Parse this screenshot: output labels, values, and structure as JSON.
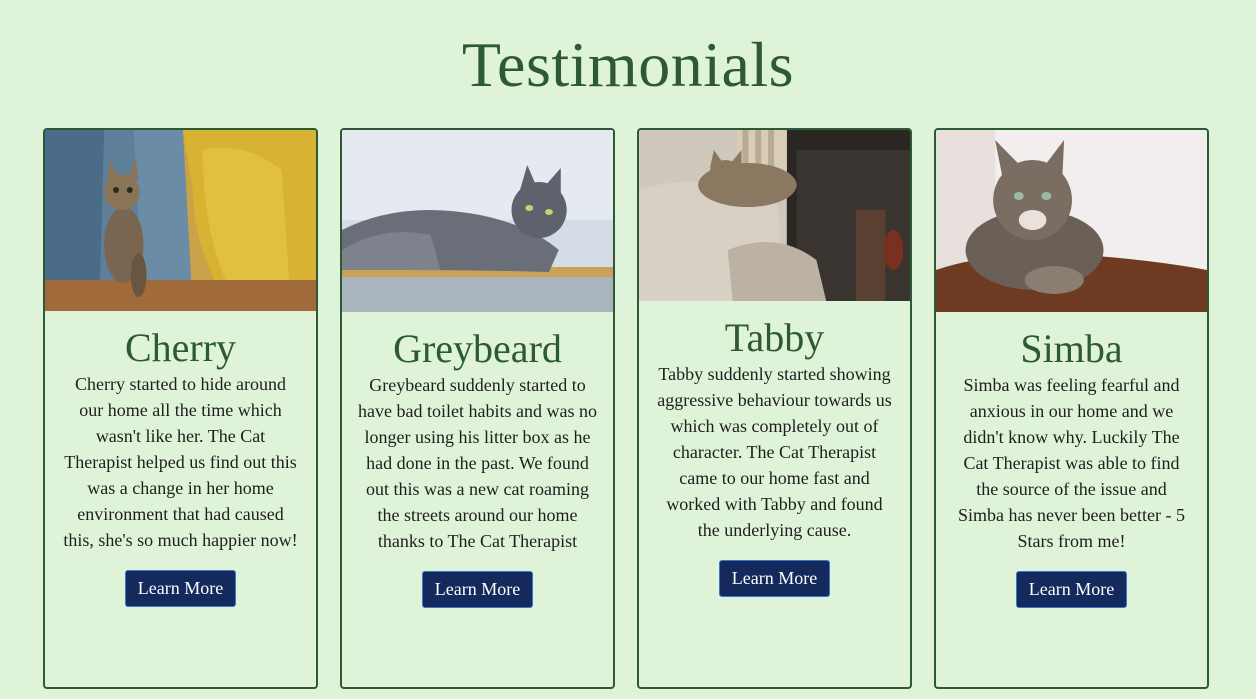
{
  "page": {
    "title": "Testimonials"
  },
  "colors": {
    "background": "#dff3d8",
    "heading": "#2d5a34",
    "border": "#2d5a34",
    "button": "#142a5c",
    "button_text": "#ffffff"
  },
  "cards": [
    {
      "name": "Cherry",
      "image": "cat-photo-cherry",
      "text": "Cherry started to hide around our home all the time which wasn't like her. The Cat Therapist helped us find out this was a change in her home environment that had caused this, she's so much happier now!",
      "button": "Learn More"
    },
    {
      "name": "Greybeard",
      "image": "cat-photo-greybeard",
      "text": "Greybeard suddenly started to have bad toilet habits and was no longer using his litter box as he had done in the past. We found out this was a new cat roaming the streets around our home thanks to The Cat Therapist",
      "button": "Learn More"
    },
    {
      "name": "Tabby",
      "image": "cat-photo-tabby",
      "text": "Tabby suddenly started showing aggressive behaviour towards us which was completely out of character. The Cat Therapist came to our home fast and worked with Tabby and found the underlying cause.",
      "button": "Learn More"
    },
    {
      "name": "Simba",
      "image": "cat-photo-simba",
      "text": "Simba was feeling fearful and anxious in our home and we didn't know why. Luckily The Cat Therapist was able to find the source of the issue and Simba has never been better - 5 Stars from me!",
      "button": "Learn More"
    }
  ]
}
